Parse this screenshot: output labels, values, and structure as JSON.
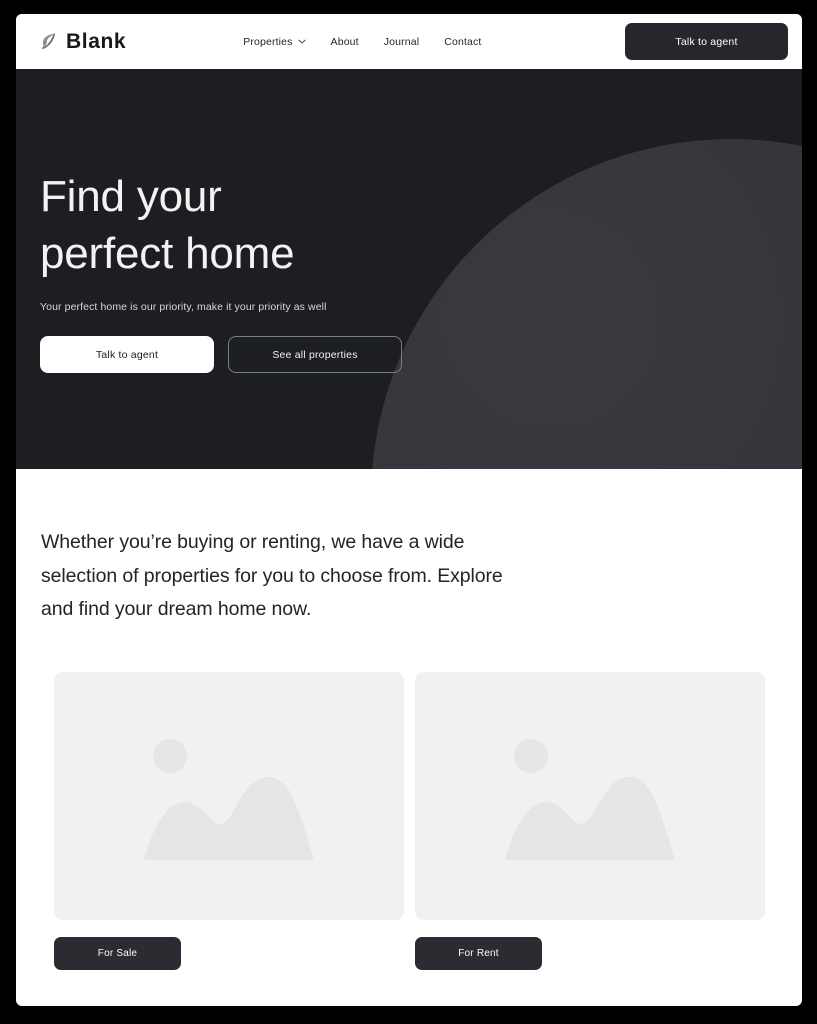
{
  "brand": {
    "name": "Blank",
    "logo_icon": "leaf-icon"
  },
  "nav": {
    "items": [
      {
        "label": "Properties",
        "has_dropdown": true,
        "icon": "chevron-down-icon"
      },
      {
        "label": "About",
        "has_dropdown": false
      },
      {
        "label": "Journal",
        "has_dropdown": false
      },
      {
        "label": "Contact",
        "has_dropdown": false
      }
    ],
    "cta_label": "Talk to agent"
  },
  "hero": {
    "title_line1": "Find your",
    "title_line2": "perfect home",
    "subtitle": "Your perfect home is our priority, make it your priority as well",
    "primary_button": "Talk to agent",
    "secondary_button": "See all properties",
    "background_color": "#1d1e22",
    "arc_color": "#36373d"
  },
  "content": {
    "lede": "Whether you’re buying or renting, we have a wide selection of properties for you to choose from. Explore and find your dream home now.",
    "cards": [
      {
        "image_placeholder": "image-placeholder-icon",
        "badge_label": "For Sale"
      },
      {
        "image_placeholder": "image-placeholder-icon",
        "badge_label": "For Rent"
      }
    ]
  },
  "colors": {
    "dark": "#1d1e22",
    "button_dark": "#2b2c31",
    "page_background": "#ffffff",
    "placeholder_grey": "#f1f1f1",
    "frame_black": "#000000"
  }
}
